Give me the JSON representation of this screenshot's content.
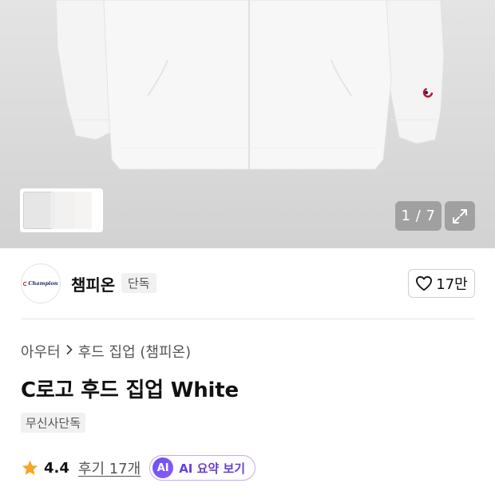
{
  "gallery": {
    "pager_text": "1 / 7",
    "icons": {
      "next": "chevron-right-icon",
      "expand": "expand-icon"
    }
  },
  "brand": {
    "name": "챔피온",
    "badge": "단독",
    "logo_text": "Champion",
    "like_count": "17만",
    "icons": {
      "like": "heart-outline-icon"
    }
  },
  "product": {
    "breadcrumb": [
      "아우터",
      "후드 집업 (챔피온)"
    ],
    "title": "C로고 후드 집업 White",
    "tag": "무신사단독"
  },
  "rating": {
    "value": "4.4",
    "review_link": "후기 17개",
    "ai_chip": "AI",
    "ai_label": "AI 요약 보기",
    "star_color": "#f5a623"
  },
  "colors": {
    "accent_purple": "#6a3fd6",
    "star": "#f5a623"
  }
}
